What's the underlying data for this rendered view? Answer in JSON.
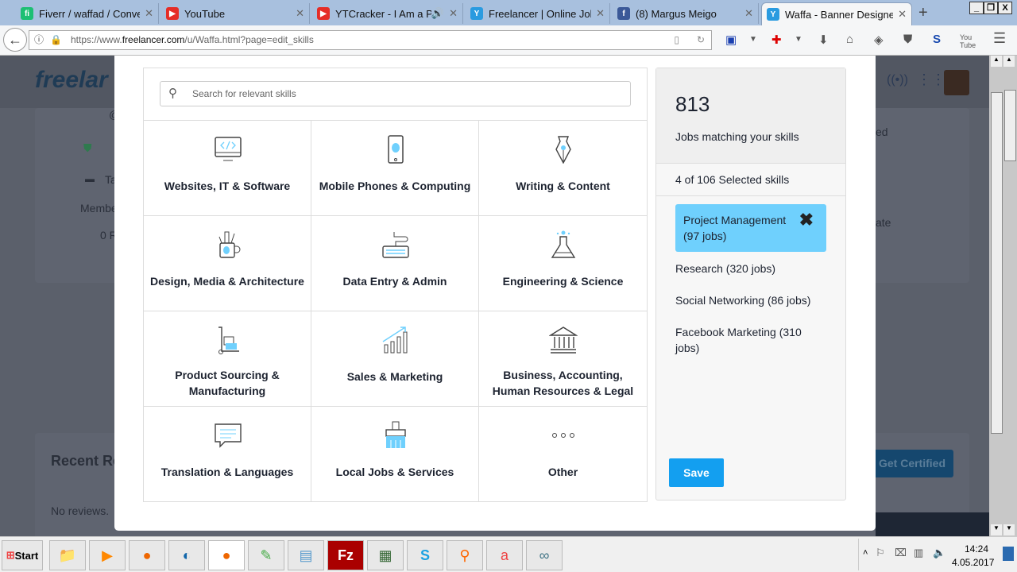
{
  "browser": {
    "tabs": [
      {
        "title": "Fiverr / waffad / Convers",
        "icon": "fiverr-icon",
        "color": "#1dbf73",
        "glyph": "fi"
      },
      {
        "title": "YouTube",
        "icon": "youtube-icon",
        "color": "#e52d27",
        "glyph": "▶"
      },
      {
        "title": "YTCracker - I Am a Pi",
        "icon": "youtube-icon",
        "color": "#e52d27",
        "glyph": "▶"
      },
      {
        "title": "Freelancer | Online Jobs |",
        "icon": "freelancer-icon",
        "color": "#2a9be0",
        "glyph": "Y"
      },
      {
        "title": "(8) Margus Meigo",
        "icon": "facebook-icon",
        "color": "#3b5998",
        "glyph": "f"
      },
      {
        "title": "Waffa - Banner Designer",
        "icon": "freelancer-icon",
        "color": "#2a9be0",
        "glyph": "Y"
      }
    ],
    "url_prefix": "https://www.",
    "url_domain": "freelancer.com",
    "url_path": "/u/Waffa.html?page=edit_skills"
  },
  "background": {
    "logo": "freelar",
    "at": "@",
    "ta": "Ta",
    "member": "Membe",
    "reviews_count": "0 R",
    "ed": "ed",
    "ate": "ate",
    "recent": "Recent Re",
    "no_reviews": "No reviews.",
    "get_certified": "Get Certified"
  },
  "modal": {
    "search_placeholder": "Search for relevant skills",
    "categories": [
      {
        "label": "Websites, IT & Software"
      },
      {
        "label": "Mobile Phones & Computing"
      },
      {
        "label": "Writing & Content"
      },
      {
        "label": "Design, Media & Architecture"
      },
      {
        "label": "Data Entry & Admin"
      },
      {
        "label": "Engineering & Science"
      },
      {
        "label": "Product Sourcing & Manufacturing"
      },
      {
        "label": "Sales & Marketing"
      },
      {
        "label": "Business, Accounting, Human Resources & Legal"
      },
      {
        "label": "Translation & Languages"
      },
      {
        "label": "Local Jobs & Services"
      },
      {
        "label": "Other"
      }
    ],
    "jobs_count": "813",
    "jobs_label": "Jobs matching your skills",
    "selected_label": "4 of 106 Selected skills",
    "skills": [
      "Project Management (97 jobs)",
      "Research (320 jobs)",
      "Social Networking (86 jobs)",
      "Facebook Marketing (310 jobs)"
    ],
    "save": "Save"
  },
  "taskbar": {
    "start": "Start",
    "time": "14:24",
    "date": "4.05.2017"
  }
}
